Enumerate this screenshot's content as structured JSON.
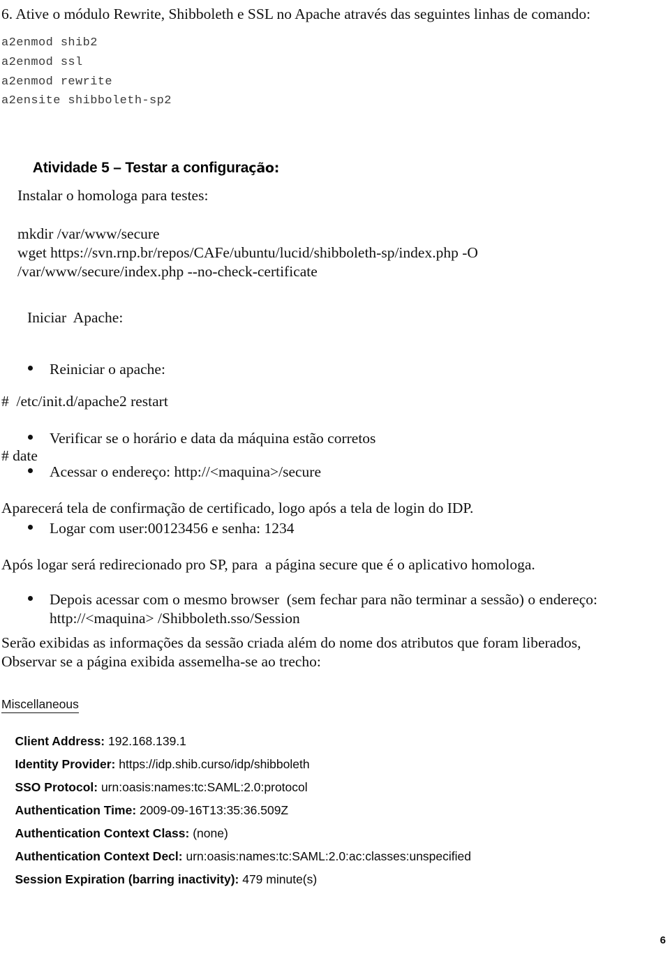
{
  "document": {
    "page_number": "6",
    "intro": {
      "heading": "6. Ative o módulo Rewrite, Shibboleth e SSL no Apache através das seguintes linhas de comando:",
      "commands": [
        "a2enmod shib2",
        "a2enmod ssl",
        "a2enmod rewrite",
        "a2ensite shibboleth-sp2"
      ]
    },
    "activity": {
      "title_main": "Atividade 5 – Testar a configura",
      "title_accented": "ção:",
      "subtitle": "Instalar o homologa para testes:",
      "install_commands": [
        "mkdir /var/www/secure",
        "wget https://svn.rnp.br/repos/CAFe/ubuntu/lucid/shibboleth-sp/index.php -O",
        "/var/www/secure/index.php --no-check-certificate"
      ],
      "start_apache_label": "Iniciar  Apache:",
      "bullet_restart": "Reiniciar o apache:",
      "cmd_restart": "#  /etc/init.d/apache2 restart",
      "bullet_check_time": "Verificar se o horário e data da máquina estão corretos",
      "cmd_date": "# date",
      "bullet_access_url": "Acessar o endereço: http://<maquina>/secure",
      "note_cert": "Aparecerá tela de confirmação de certificado, logo após a tela de login do IDP.",
      "bullet_login": "Logar com user:00123456 e senha: 1234",
      "note_redirect": "Após logar será redirecionado pro SP, para  a página secure que é o aplicativo homologa.",
      "bullet_session": "Depois acessar com o mesmo browser  (sem fechar para não terminar a sessão) o endereço:\nhttp://<maquina> /Shibboleth.sso/Session",
      "note_session_1": "Serão exibidas as informações da sessão criada além do nome dos atributos que foram liberados,",
      "note_session_2": "Observar se a página exibida assemelha-se ao trecho:"
    },
    "miscellaneous": {
      "title": "Miscellaneous",
      "rows": [
        {
          "key": "Client Address:",
          "value": " 192.168.139.1"
        },
        {
          "key": "Identity Provider:",
          "value": " https://idp.shib.curso/idp/shibboleth"
        },
        {
          "key": "SSO Protocol:",
          "value": " urn:oasis:names:tc:SAML:2.0:protocol"
        },
        {
          "key": "Authentication Time:",
          "value": " 2009-09-16T13:35:36.509Z"
        },
        {
          "key": "Authentication Context Class:",
          "value": " (none)"
        },
        {
          "key": "Authentication Context Decl:",
          "value": " urn:oasis:names:tc:SAML:2.0:ac:classes:unspecified"
        },
        {
          "key": "Session Expiration (barring inactivity):",
          "value": " 479 minute(s)"
        }
      ]
    }
  }
}
